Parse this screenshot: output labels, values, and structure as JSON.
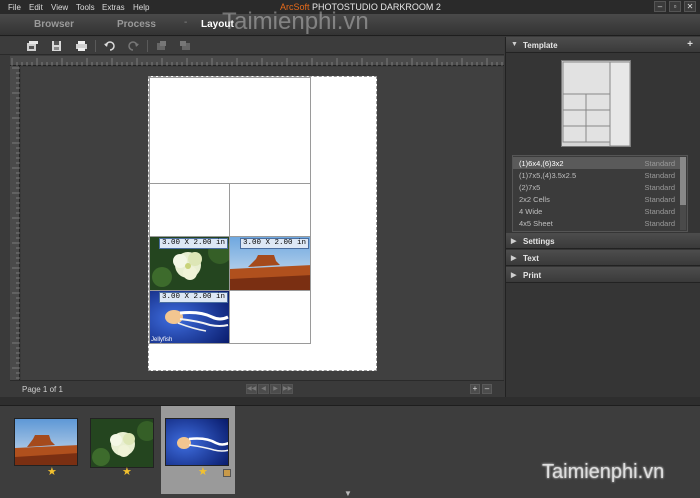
{
  "menu": [
    {
      "label": "File"
    },
    {
      "label": "Edit"
    },
    {
      "label": "View"
    },
    {
      "label": "Tools"
    },
    {
      "label": "Extras"
    },
    {
      "label": "Help"
    }
  ],
  "app_title": {
    "brand": "ArcSoft",
    "name": "PHOTOSTUDIO DARKROOM 2"
  },
  "window_controls": {
    "minimize": "–",
    "restore": "▫",
    "close": "✕"
  },
  "modules": [
    {
      "label": "Browser",
      "active": false
    },
    {
      "label": "Process",
      "active": false
    },
    {
      "label": "Layout",
      "active": true
    }
  ],
  "toolbar": {
    "icons": [
      "open-template-icon",
      "save-icon",
      "print-icon",
      "undo-icon",
      "redo-icon",
      "rotate-left-icon",
      "rotate-right-icon"
    ]
  },
  "layout": {
    "cells": [
      {
        "label": "3.00 X 2.00 in",
        "image": "flower"
      },
      {
        "label": "3.00 X 2.00 in",
        "image": "desert"
      },
      {
        "label": "3.00 X 2.00 in",
        "image": "jellyfish",
        "caption": "Jellyfish"
      }
    ]
  },
  "footer": {
    "page_indicator": "Page 1 of 1"
  },
  "right_panel": {
    "template_title": "Template",
    "add_symbol": "+",
    "templates": [
      {
        "name": "(1)6x4,(6)3x2",
        "type": "Standard",
        "selected": true
      },
      {
        "name": "(1)7x5,(4)3.5x2.5",
        "type": "Standard",
        "selected": false
      },
      {
        "name": "(2)7x5",
        "type": "Standard",
        "selected": false
      },
      {
        "name": "2x2 Cells",
        "type": "Standard",
        "selected": false
      },
      {
        "name": "4 Wide",
        "type": "Standard",
        "selected": false
      },
      {
        "name": "4x5 Sheet",
        "type": "Standard",
        "selected": false
      }
    ],
    "sections": [
      {
        "title": "Settings"
      },
      {
        "title": "Text"
      },
      {
        "title": "Print"
      }
    ]
  },
  "filmstrip": {
    "thumbs": [
      {
        "image": "desert",
        "selected": false
      },
      {
        "image": "flower",
        "selected": false
      },
      {
        "image": "jellyfish",
        "selected": true
      }
    ]
  },
  "watermark": "Taimienphi.vn",
  "colors": {
    "accent": "#e66a1a",
    "star": "#f3c12e",
    "background": "#3a3a3a"
  }
}
